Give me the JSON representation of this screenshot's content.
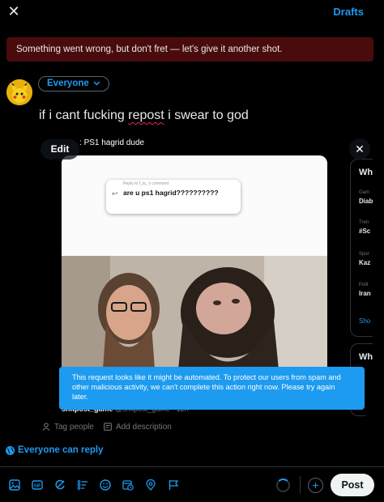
{
  "header": {
    "drafts_label": "Drafts"
  },
  "error_banner": {
    "text": "Something went wrong, but don't fret — let's give it another shot."
  },
  "composer": {
    "audience_label": "Everyone",
    "text_before": "if i cant fucking ",
    "text_misspelled": "repost",
    "text_after": " i swear to god"
  },
  "media": {
    "edit_label": "Edit",
    "tiktok": {
      "author": "PS1 hagrid dude",
      "comment_meta": "Reply to f_ia_'s comment",
      "comment_text": "are u ps1 hagrid??????????"
    },
    "below_card": {
      "name": "shitpost_game",
      "handle": "@shitpost_game · 12h"
    },
    "side_panel": {
      "title": "Wh",
      "rows": [
        {
          "small": "Gam",
          "big": "Diab"
        },
        {
          "small": "Tren",
          "big": "#Sc"
        },
        {
          "small": "Spor",
          "big": "Kaz"
        },
        {
          "small": "Polit",
          "big": "Iran"
        }
      ],
      "link": "Sho",
      "title2": "Wh"
    }
  },
  "toast": {
    "text": "This request looks like it might be automated. To protect our users from spam and other malicious activity, we can't complete this action right now. Please try again later."
  },
  "media_actions": {
    "tag_people": "Tag people",
    "add_description": "Add description"
  },
  "reply_setting": {
    "label": "Everyone can reply"
  },
  "toolbar": {
    "icons": [
      "image-icon",
      "gif-icon",
      "grok-icon",
      "poll-icon",
      "emoji-icon",
      "schedule-icon",
      "location-icon",
      "flag-icon"
    ]
  },
  "post_label": "Post",
  "colors": {
    "accent": "#1d9bf0",
    "error_bg": "#4a0b0d",
    "toast_bg": "#1d9bf0"
  }
}
